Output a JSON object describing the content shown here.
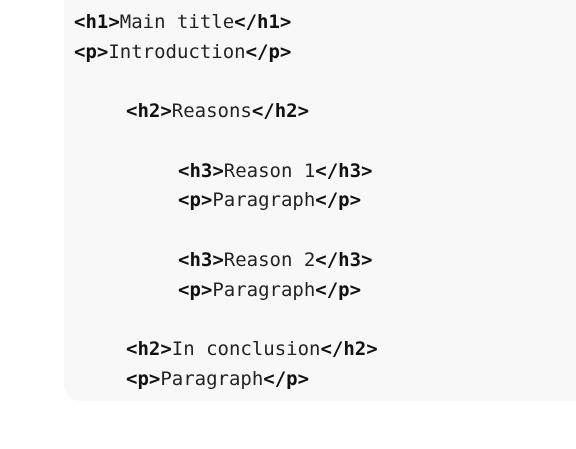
{
  "code": {
    "lines": [
      {
        "open": "<h1>",
        "text": "Main title",
        "close": "</h1>"
      },
      {
        "open": "<p>",
        "text": "Introduction",
        "close": "</p>"
      },
      {
        "open": "<h2>",
        "text": "Reasons",
        "close": "</h2>"
      },
      {
        "open": "<h3>",
        "text": "Reason 1",
        "close": "</h3>"
      },
      {
        "open": "<p>",
        "text": "Paragraph",
        "close": "</p>"
      },
      {
        "open": "<h3>",
        "text": "Reason 2",
        "close": "</h3>"
      },
      {
        "open": "<p>",
        "text": "Paragraph",
        "close": "</p>"
      },
      {
        "open": "<h2>",
        "text": "In conclusion",
        "close": "</h2>"
      },
      {
        "open": "<p>",
        "text": "Paragraph",
        "close": "</p>"
      }
    ]
  }
}
